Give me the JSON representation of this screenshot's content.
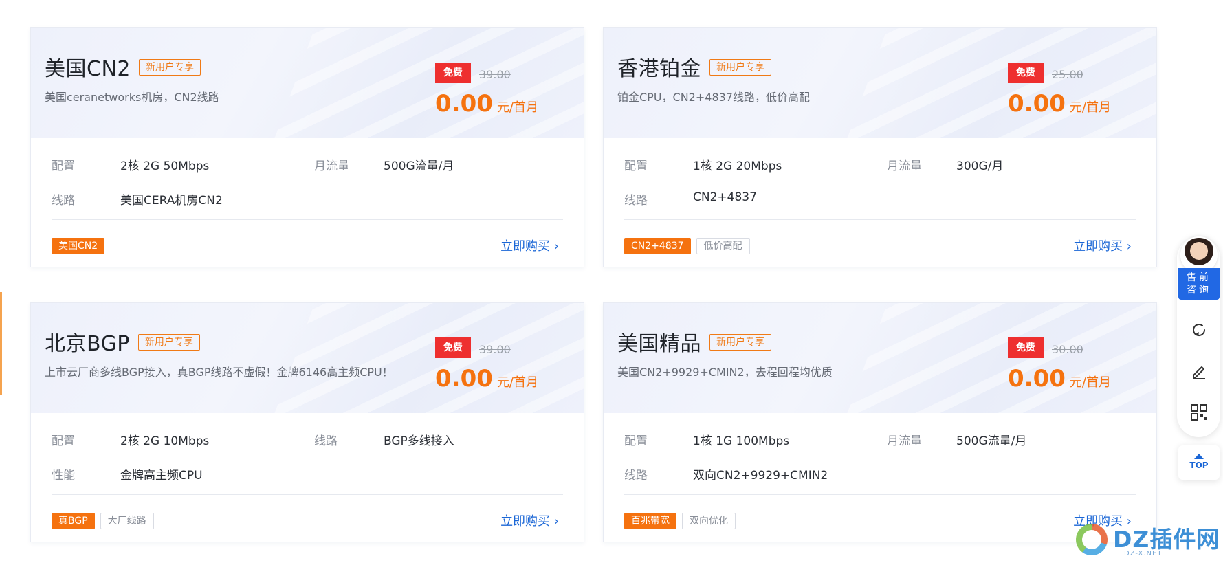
{
  "cards": [
    {
      "title": "美国CN2",
      "promo": "新用户专享",
      "desc": "美国ceranetworks机房，CN2线路",
      "free": "免费",
      "orig_price": "39.00",
      "price": "0.00",
      "unit": "元/首月",
      "spec1_label": "配置",
      "spec1_value": "2核 2G 50Mbps",
      "spec2_label": "月流量",
      "spec2_value": "500G流量/月",
      "spec3_label": "线路",
      "spec3_value": "美国CERA机房CN2",
      "tags": [
        "美国CN2"
      ],
      "buy": "立即购买"
    },
    {
      "title": "香港铂金",
      "promo": "新用户专享",
      "desc": "铂金CPU，CN2+4837线路，低价高配",
      "free": "免费",
      "orig_price": "25.00",
      "price": "0.00",
      "unit": "元/首月",
      "spec1_label": "配置",
      "spec1_value": "1核 2G 20Mbps",
      "spec2_label": "月流量",
      "spec2_value": "300G/月",
      "spec3_label": "线路",
      "spec3_value": "CN2+4837",
      "tags": [
        "CN2+4837",
        "低价高配"
      ],
      "buy": "立即购买"
    },
    {
      "title": "北京BGP",
      "promo": "新用户专享",
      "desc": "上市云厂商多线BGP接入，真BGP线路不虚假！金牌6146高主频CPU！",
      "free": "免费",
      "orig_price": "39.00",
      "price": "0.00",
      "unit": "元/首月",
      "spec1_label": "配置",
      "spec1_value": "2核 2G 10Mbps",
      "spec2_label": "线路",
      "spec2_value": "BGP多线接入",
      "spec3_label": "性能",
      "spec3_value": "金牌高主频CPU",
      "tags": [
        "真BGP",
        "大厂线路"
      ],
      "buy": "立即购买"
    },
    {
      "title": "美国精品",
      "promo": "新用户专享",
      "desc": "美国CN2+9929+CMIN2，去程回程均优质",
      "free": "免费",
      "orig_price": "30.00",
      "price": "0.00",
      "unit": "元/首月",
      "spec1_label": "配置",
      "spec1_value": "1核 1G 100Mbps",
      "spec2_label": "月流量",
      "spec2_value": "500G流量/月",
      "spec3_label": "线路",
      "spec3_value": "双向CN2+9929+CMIN2",
      "tags": [
        "百兆带宽",
        "双向优化"
      ],
      "buy": "立即购买"
    }
  ],
  "sidebar": {
    "consult_line1": "售前",
    "consult_line2": "咨询",
    "top_label": "TOP",
    "icons": [
      "refresh-icon",
      "edit-icon",
      "qrcode-icon"
    ]
  },
  "watermark": {
    "text": "DZ插件网",
    "sub": "DZ-X.NET"
  },
  "colors": {
    "accent_orange": "#f5720f",
    "free_red": "#ee2f2f",
    "link_blue": "#1a66d6",
    "consult_blue": "#2168e4"
  }
}
